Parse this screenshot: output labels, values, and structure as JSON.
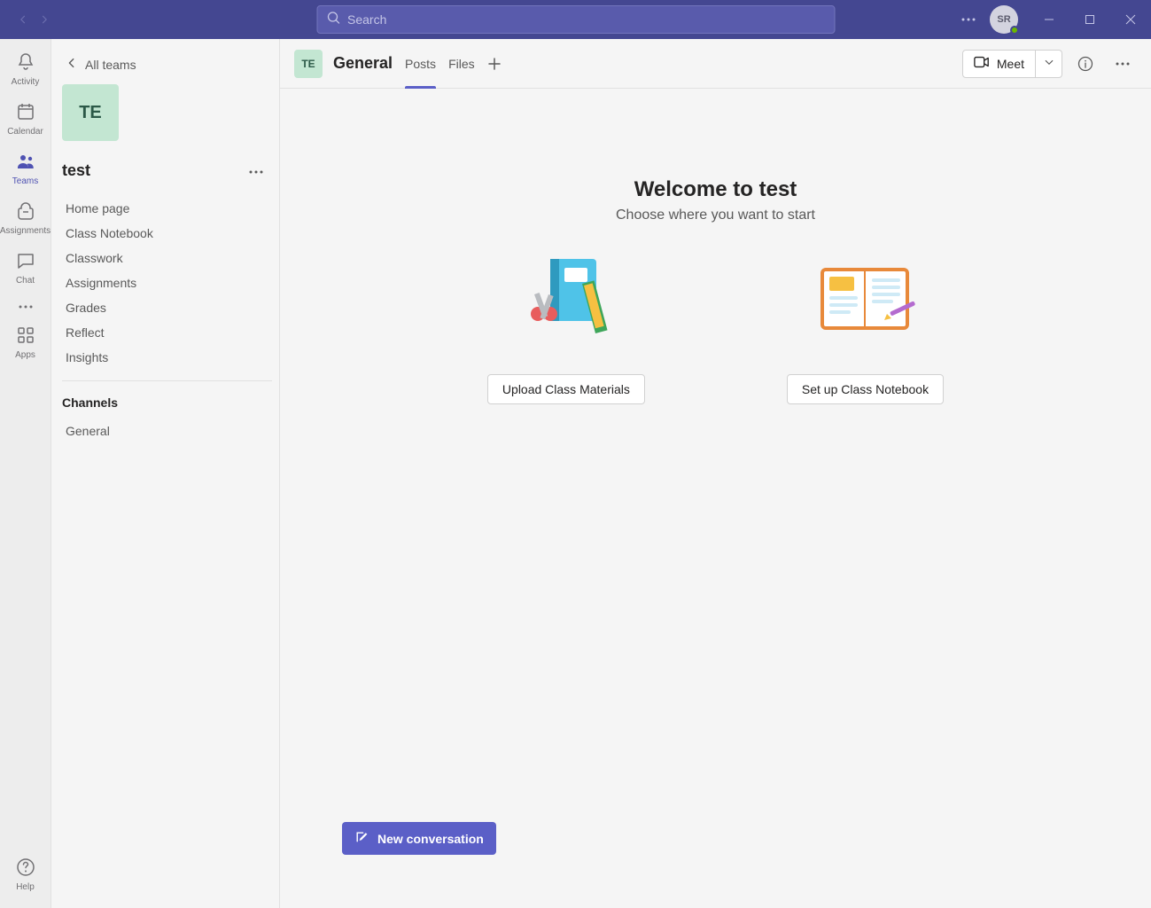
{
  "titlebar": {
    "search_placeholder": "Search",
    "avatar_initials": "SR"
  },
  "rail": {
    "activity": "Activity",
    "calendar": "Calendar",
    "teams": "Teams",
    "assignments": "Assignments",
    "chat": "Chat",
    "apps": "Apps",
    "help": "Help"
  },
  "teampanel": {
    "back_label": "All teams",
    "team_initials": "TE",
    "team_name": "test",
    "links": {
      "home": "Home page",
      "notebook": "Class Notebook",
      "classwork": "Classwork",
      "assignments": "Assignments",
      "grades": "Grades",
      "reflect": "Reflect",
      "insights": "Insights"
    },
    "channels_header": "Channels",
    "channels": {
      "general": "General"
    }
  },
  "header": {
    "team_initials": "TE",
    "channel_title": "General",
    "tabs": {
      "posts": "Posts",
      "files": "Files"
    },
    "meet_label": "Meet"
  },
  "stage": {
    "welcome_title": "Welcome to test",
    "welcome_subtitle": "Choose where you want to start",
    "upload_btn": "Upload Class Materials",
    "notebook_btn": "Set up Class Notebook",
    "new_conversation": "New conversation"
  }
}
